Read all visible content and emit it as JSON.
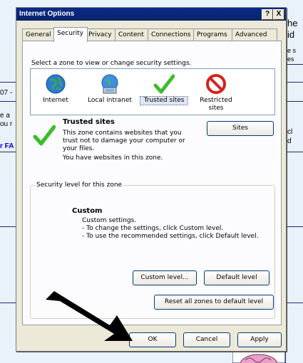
{
  "background": {
    "right_texts": [
      "he",
      "id",
      "e s",
      "es",
      "cl",
      "d"
    ],
    "left_texts": [
      "07 -",
      "e a",
      "ou r",
      "r FA"
    ]
  },
  "dialog": {
    "title": "Internet Options",
    "help_button": "?",
    "close_button": "X",
    "tabs": [
      "General",
      "Security",
      "Privacy",
      "Content",
      "Connections",
      "Programs",
      "Advanced"
    ],
    "active_tab": "Security",
    "zone_prompt": "Select a zone to view or change security settings.",
    "zones": [
      {
        "label": "Internet",
        "icon": "globe-icon"
      },
      {
        "label": "Local intranet",
        "icon": "intranet-icon"
      },
      {
        "label": "Trusted sites",
        "icon": "checkmark-icon",
        "selected": true
      },
      {
        "label": "Restricted sites",
        "icon": "restricted-icon"
      }
    ],
    "selected_zone": {
      "title": "Trusted sites",
      "description": [
        "This zone contains websites that you",
        "trust not to damage your computer or",
        "your files.",
        "You have websites in this zone."
      ],
      "sites_button": "Sites"
    },
    "security_level": {
      "legend": "Security level for this zone",
      "title": "Custom",
      "lines": [
        "Custom settings.",
        "- To change the settings, click Custom level.",
        "- To use the recommended settings, click Default level."
      ],
      "custom_level_button": "Custom level...",
      "default_level_button": "Default level",
      "reset_button": "Reset all zones to default level"
    },
    "ok_button": "OK",
    "cancel_button": "Cancel",
    "apply_button": "Apply"
  },
  "colors": {
    "titlebar": "#0a246a",
    "dialog_bg": "#ece9d8",
    "panel_bg": "#fcfcfe",
    "button_border": "#003c74",
    "arrow": "#000000"
  }
}
